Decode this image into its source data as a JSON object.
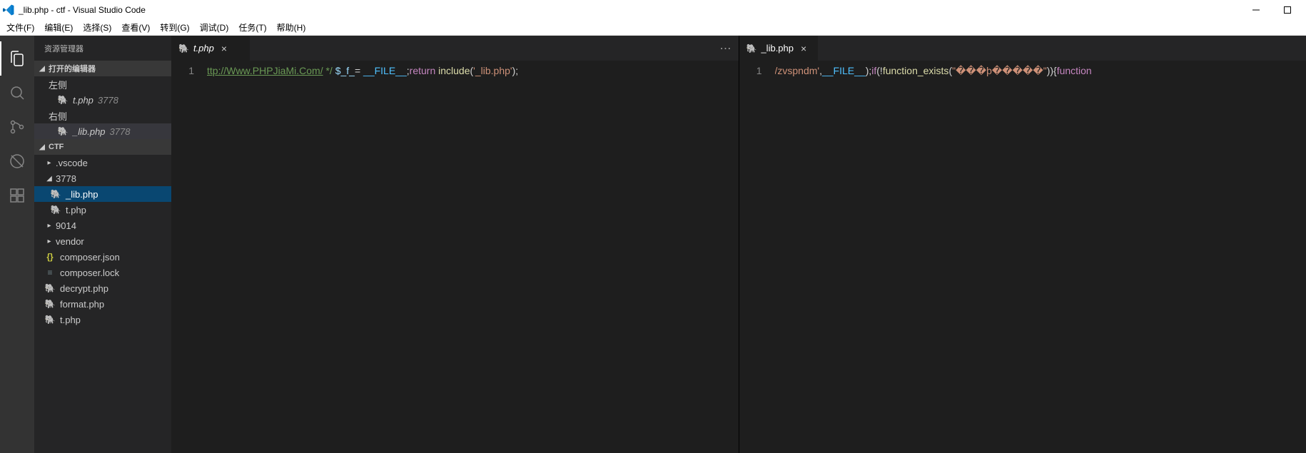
{
  "window": {
    "title": "_lib.php - ctf - Visual Studio Code"
  },
  "menu": {
    "file": "文件(F)",
    "edit": "编辑(E)",
    "select": "选择(S)",
    "view": "查看(V)",
    "go": "转到(G)",
    "debug": "调试(D)",
    "task": "任务(T)",
    "help": "帮助(H)"
  },
  "explorer": {
    "title": "资源管理器",
    "open_editors_header": "打开的编辑器",
    "left_group": "左侧",
    "right_group": "右侧",
    "left_file": {
      "name": "t.php",
      "path": "3778"
    },
    "right_file": {
      "name": "_lib.php",
      "path": "3778"
    },
    "workspace_header": "CTF",
    "tree": {
      "vscode": ".vscode",
      "d3778": "3778",
      "lib_php": "_lib.php",
      "t_php": "t.php",
      "d9014": "9014",
      "vendor": "vendor",
      "composer_json": "composer.json",
      "composer_lock": "composer.lock",
      "decrypt_php": "decrypt.php",
      "format_php": "format.php",
      "root_t_php": "t.php"
    }
  },
  "left_editor": {
    "tab": "t.php",
    "line_no": "1",
    "code": {
      "c1": "ttp://Www.PHPJiaMi.Com/",
      "c2": " */ ",
      "v1": "$_f_",
      "eq": "= ",
      "const1": "__FILE__",
      "semi1": ";",
      "kw1": "return",
      "sp1": " ",
      "fn1": "include",
      "paren1": "(",
      "str1": "'_lib.php'",
      "paren2": ")",
      "semi2": ";"
    }
  },
  "right_editor": {
    "tab": "_lib.php",
    "line_no": "1",
    "code": {
      "s1": "/zvspndm'",
      "p1": ",",
      "const1": "__FILE__",
      "p2": ");",
      "kw_if": "if",
      "p3": "(!",
      "fn1": "function_exists",
      "p4": "(",
      "str1": "\"���þ�����\"",
      "p5": ")){",
      "kw_fn": "function"
    }
  }
}
